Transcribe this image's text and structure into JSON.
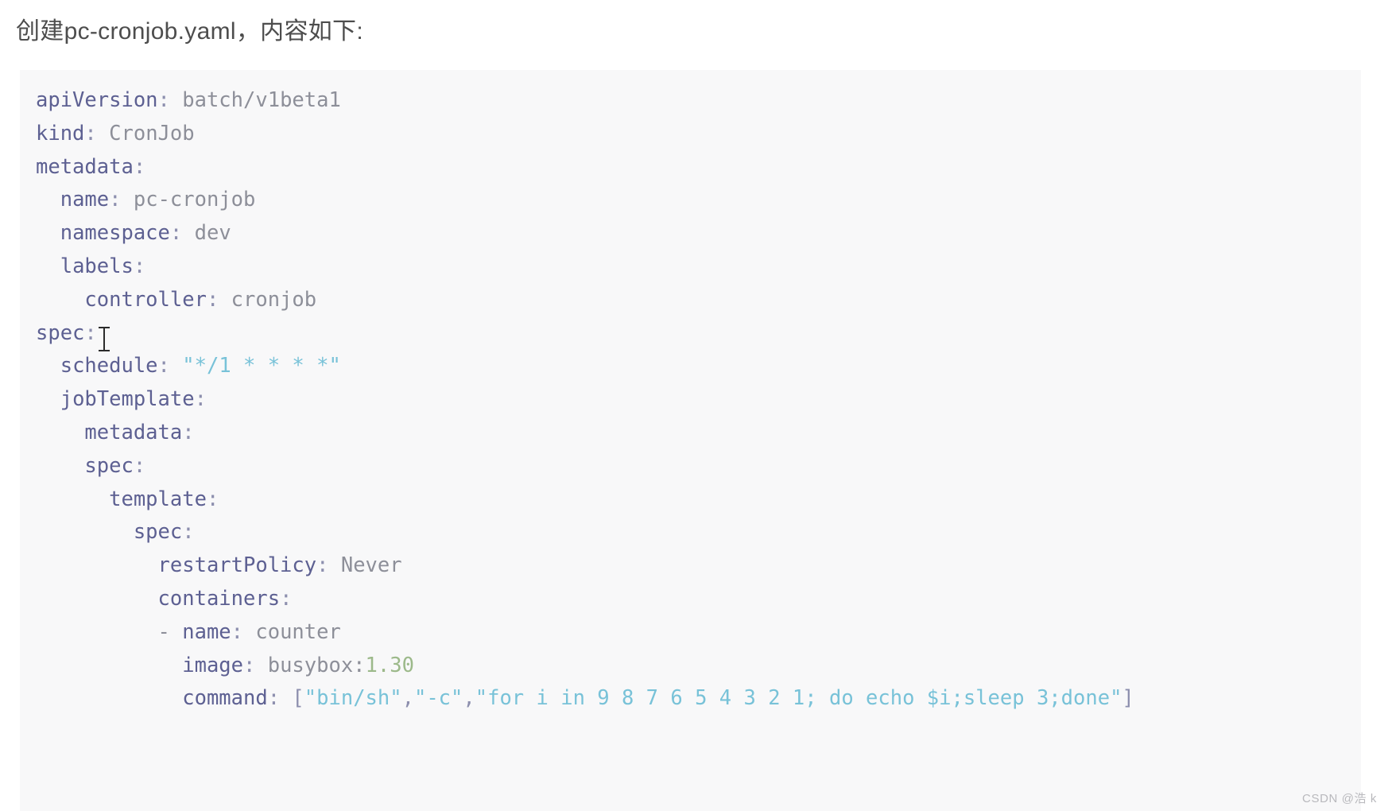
{
  "document": {
    "intro_text": "创建pc-cronjob.yaml，内容如下:",
    "watermark": "CSDN @浩 k",
    "filename": "pc-cronjob.yaml",
    "language": "yaml"
  },
  "colors": {
    "page_background": "#ffffff",
    "code_background": "#f8f8f9",
    "key": "#5d6092",
    "value": "#8d8f99",
    "string": "#78c2d8",
    "number": "#9cb98a",
    "intro": "#4d4d4d",
    "watermark": "#b9b9bd"
  },
  "code": {
    "lines": [
      {
        "indent": "",
        "key": "apiVersion",
        "sep": ": ",
        "value": "batch/v1beta1",
        "value_type": "plain"
      },
      {
        "indent": "",
        "key": "kind",
        "sep": ": ",
        "value": "CronJob",
        "value_type": "plain"
      },
      {
        "indent": "",
        "key": "metadata",
        "sep": ":",
        "value": "",
        "value_type": "plain"
      },
      {
        "indent": "  ",
        "key": "name",
        "sep": ": ",
        "value": "pc-cronjob",
        "value_type": "plain"
      },
      {
        "indent": "  ",
        "key": "namespace",
        "sep": ": ",
        "value": "dev",
        "value_type": "plain"
      },
      {
        "indent": "  ",
        "key": "labels",
        "sep": ":",
        "value": "",
        "value_type": "plain"
      },
      {
        "indent": "    ",
        "key": "controller",
        "sep": ": ",
        "value": "cronjob",
        "value_type": "plain"
      },
      {
        "indent": "",
        "key": "spec",
        "sep": ":",
        "value": "",
        "value_type": "plain"
      },
      {
        "indent": "  ",
        "key": "schedule",
        "sep": ": ",
        "value": "\"*/1 * * * *\"",
        "value_type": "string"
      },
      {
        "indent": "  ",
        "key": "jobTemplate",
        "sep": ":",
        "value": "",
        "value_type": "plain"
      },
      {
        "indent": "    ",
        "key": "metadata",
        "sep": ":",
        "value": "",
        "value_type": "plain"
      },
      {
        "indent": "    ",
        "key": "spec",
        "sep": ":",
        "value": "",
        "value_type": "plain"
      },
      {
        "indent": "      ",
        "key": "template",
        "sep": ":",
        "value": "",
        "value_type": "plain"
      },
      {
        "indent": "        ",
        "key": "spec",
        "sep": ":",
        "value": "",
        "value_type": "plain"
      },
      {
        "indent": "          ",
        "key": "restartPolicy",
        "sep": ": ",
        "value": "Never",
        "value_type": "plain"
      },
      {
        "indent": "          ",
        "key": "containers",
        "sep": ":",
        "value": "",
        "value_type": "plain"
      },
      {
        "indent": "          - ",
        "key": "name",
        "sep": ": ",
        "value": "counter",
        "value_type": "plain"
      },
      {
        "indent": "            ",
        "key": "image",
        "sep": ": ",
        "value": "busybox:1.30",
        "value_type": "image"
      },
      {
        "indent": "            ",
        "key": "command",
        "sep": ": ",
        "value": "[\"bin/sh\",\"-c\",\"for i in 9 8 7 6 5 4 3 2 1; do echo $i;sleep 3;done\"]",
        "value_type": "array"
      }
    ],
    "raw": "apiVersion: batch/v1beta1\nkind: CronJob\nmetadata:\n  name: pc-cronjob\n  namespace: dev\n  labels:\n    controller: cronjob\nspec:\n  schedule: \"*/1 * * * *\"\n  jobTemplate:\n    metadata:\n    spec:\n      template:\n        spec:\n          restartPolicy: Never\n          containers:\n          - name: counter\n            image: busybox:1.30\n            command: [\"bin/sh\",\"-c\",\"for i in 9 8 7 6 5 4 3 2 1; do echo $i;sleep 3;done\"]"
  },
  "cursor": {
    "type": "text-ibeam",
    "after_line": 8
  }
}
